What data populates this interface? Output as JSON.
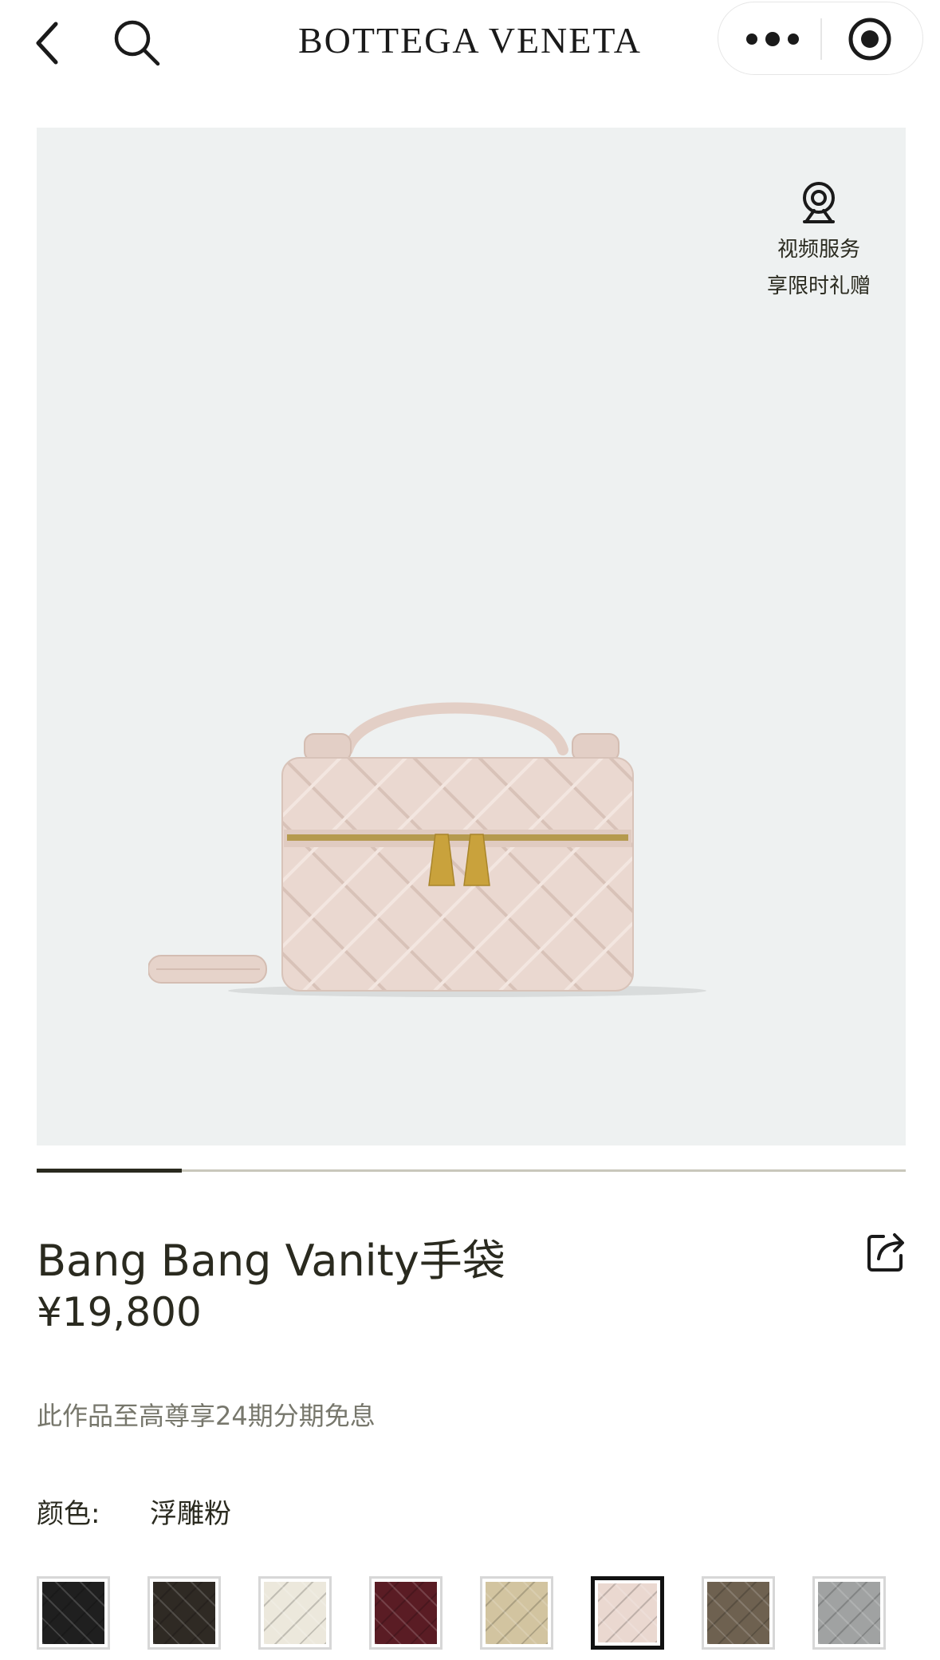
{
  "header": {
    "brand": "BOTTEGA VENETA"
  },
  "hero": {
    "video_service_label": "视频服务",
    "video_service_promo": "享限时礼赠",
    "background_color": "#eef1f1",
    "bag_color": "#ead8d0",
    "hardware_color": "#c9a23c"
  },
  "gallery": {
    "progress_fraction": 0.167
  },
  "product": {
    "title": "Bang Bang Vanity手袋",
    "price": "¥19,800",
    "installment_note": "此作品至高尊享24期分期免息",
    "color_label": "颜色:",
    "color_value": "浮雕粉"
  },
  "swatches": [
    {
      "name": "black",
      "color": "#1f1f1f",
      "selected": false
    },
    {
      "name": "dark-brown",
      "color": "#2f2a24",
      "selected": false
    },
    {
      "name": "cream",
      "color": "#ece8dc",
      "selected": false
    },
    {
      "name": "burgundy",
      "color": "#5a1c24",
      "selected": false
    },
    {
      "name": "sand",
      "color": "#d2c4a0",
      "selected": false
    },
    {
      "name": "pink",
      "color": "#ead8d0",
      "selected": true
    },
    {
      "name": "taupe",
      "color": "#6e6150",
      "selected": false
    },
    {
      "name": "grey",
      "color": "#a0a2a2",
      "selected": false
    }
  ],
  "icons": {
    "back": "chevron-left-icon",
    "search": "search-icon",
    "more": "more-dots-icon",
    "target": "record-target-icon",
    "video": "webcam-icon",
    "share": "share-icon"
  }
}
